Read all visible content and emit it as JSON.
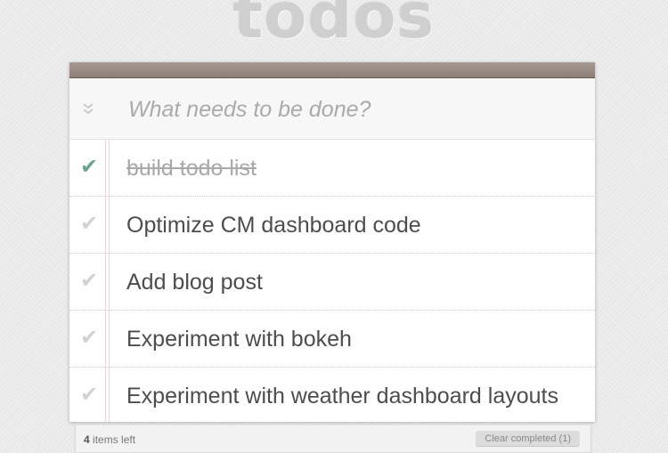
{
  "app": {
    "title": "todos"
  },
  "new_todo": {
    "placeholder": "What needs to be done?",
    "value": "",
    "toggle_all_icon": "double-chevron-down-icon"
  },
  "todos": [
    {
      "label": "build todo list",
      "completed": true
    },
    {
      "label": "Optimize CM dashboard code",
      "completed": false
    },
    {
      "label": "Add blog post",
      "completed": false
    },
    {
      "label": "Experiment with bokeh",
      "completed": false
    },
    {
      "label": "Experiment with weather dashboard layouts",
      "completed": false
    }
  ],
  "footer": {
    "count_number": "4",
    "count_suffix": "items left",
    "clear_label": "Clear completed (1)"
  },
  "colors": {
    "check_done": "#6da28c",
    "check_pending": "#d2d2d2",
    "header_band": "#8c7d76"
  }
}
